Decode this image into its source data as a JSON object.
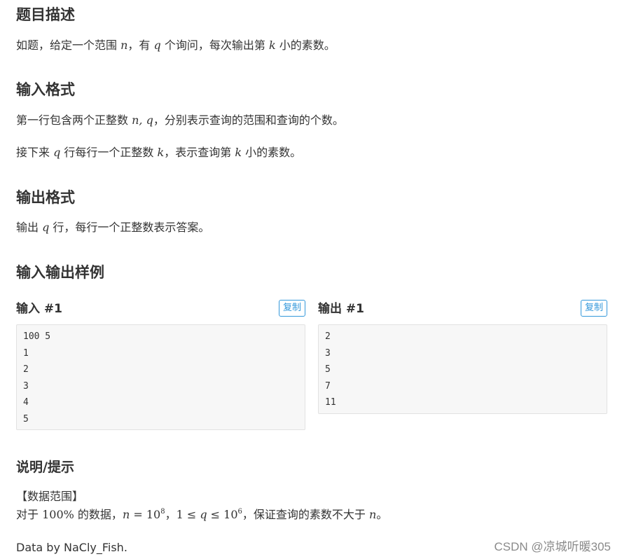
{
  "description": {
    "title": "题目描述",
    "text_a": "如题，给定一个范围 ",
    "var_n": "n",
    "text_b": "，有 ",
    "var_q": "q",
    "text_c": " 个询问，每次输出第 ",
    "var_k": "k",
    "text_d": " 小的素数。"
  },
  "input_format": {
    "title": "输入格式",
    "line1_a": "第一行包含两个正整数 ",
    "line1_vars": "n, q",
    "line1_b": "，分别表示查询的范围和查询的个数。",
    "line2_a": "接下来 ",
    "line2_var_q": "q",
    "line2_b": " 行每行一个正整数 ",
    "line2_var_k": "k",
    "line2_c": "，表示查询第 ",
    "line2_var_k2": "k",
    "line2_d": " 小的素数。"
  },
  "output_format": {
    "title": "输出格式",
    "text_a": "输出 ",
    "var_q": "q",
    "text_b": " 行，每行一个正整数表示答案。"
  },
  "samples": {
    "title": "输入输出样例",
    "input_label": "输入 #1",
    "output_label": "输出 #1",
    "copy_label": "复制",
    "input_lines": [
      "100 5",
      "1",
      "2",
      "3",
      "4",
      "5"
    ],
    "output_lines": [
      "2",
      "3",
      "5",
      "7",
      "11"
    ]
  },
  "hint": {
    "title": "说明/提示",
    "range_heading": "【数据范围】",
    "line_a": "对于 ",
    "percent": "100%",
    "line_b": " 的数据，",
    "eq1_var": "n",
    "eq1_mid": " = 10",
    "eq1_exp": "8",
    "sep": "，",
    "eq2_a": "1 ≤ ",
    "eq2_var": "q",
    "eq2_b": " ≤ 10",
    "eq2_exp": "6",
    "line_c": "，保证查询的素数不大于 ",
    "end_var": "n",
    "end": "。",
    "credit": "Data by NaCly_Fish."
  },
  "watermark": "CSDN @凉城听暖305"
}
